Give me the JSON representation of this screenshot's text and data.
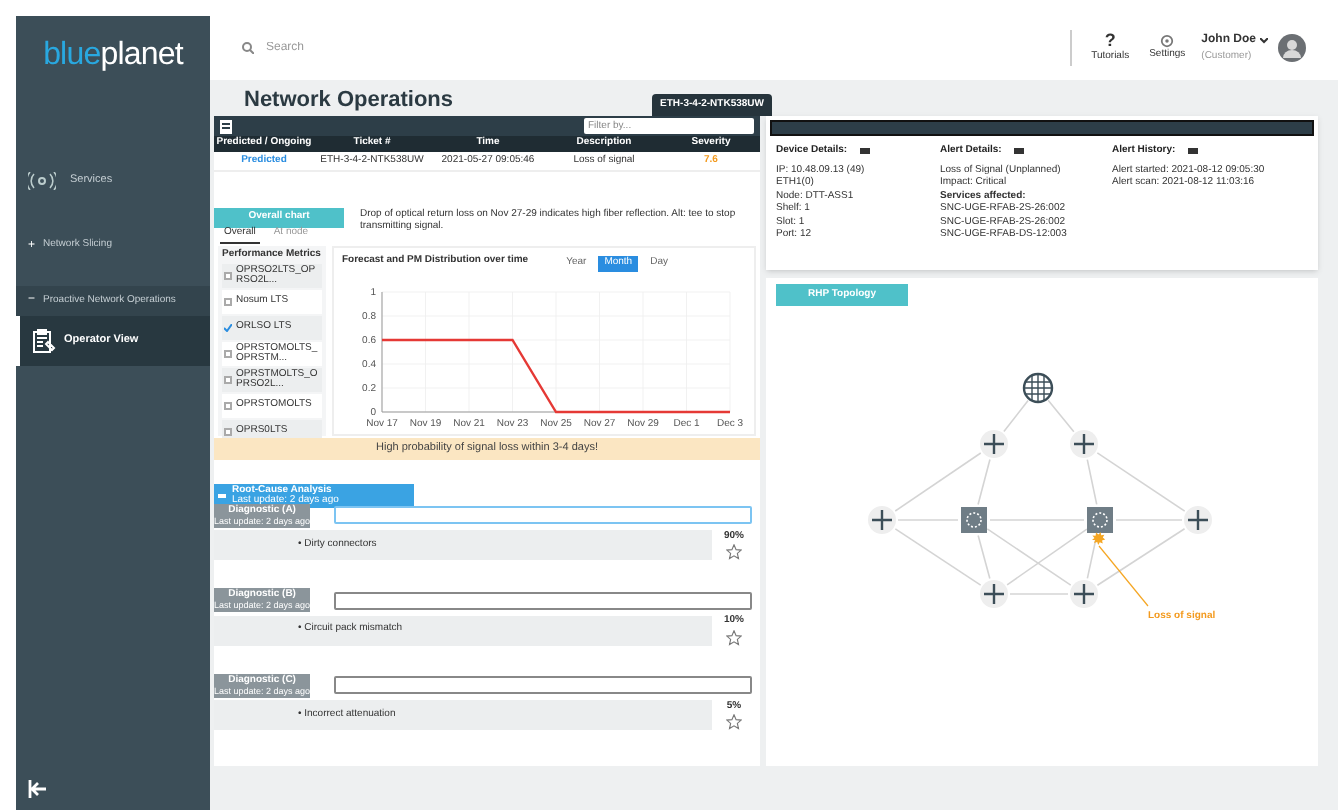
{
  "sidebar": {
    "logo": {
      "part_1": "blue",
      "part_2": "planet"
    },
    "items": [
      {
        "kind": "icon",
        "label": "Services",
        "selected": false
      },
      {
        "kind": "expand",
        "marker": "+",
        "label": "Network Slicing",
        "selected": false
      },
      {
        "kind": "expand",
        "marker": "−",
        "label": "Proactive Network Operations",
        "selected": false
      },
      {
        "kind": "sub",
        "label": "Operator View",
        "selected": true
      }
    ]
  },
  "topbar": {
    "search": {
      "placeholder": "Search"
    },
    "tutorials": {
      "glyph": "?",
      "label": "Tutorials"
    },
    "settings": {
      "label": "Settings"
    },
    "user": {
      "name": "John Doe",
      "role": "(Customer)"
    }
  },
  "page": {
    "title": "Network Operations",
    "badge": "ETH-3-4-2-NTK538UW"
  },
  "tickets": {
    "filter": {
      "placeholder": "Filter by..."
    },
    "columns": [
      "Predicted / Ongoing",
      "Ticket #",
      "Time",
      "Description",
      "Severity"
    ],
    "rows": [
      {
        "status": "Predicted",
        "ticket": "ETH-3-4-2-NTK538UW",
        "time": "2021-05-27 09:05:46",
        "description": "Loss of signal",
        "severity": "7.6"
      }
    ]
  },
  "overall": {
    "tab": "Overall chart",
    "note": "Drop of optical return loss on Nov 27-29 indicates high fiber reflection. Alt: tee to stop transmitting signal.",
    "view_tabs": [
      {
        "label": "Overall",
        "selected": true
      },
      {
        "label": "At node",
        "selected": false
      }
    ],
    "metrics": {
      "title": "Performance Metrics",
      "items": [
        {
          "label": "OPRSO2LTS_OPRSO2L...",
          "checked": false
        },
        {
          "label": "Nosum LTS",
          "checked": false
        },
        {
          "label": "ORLSO LTS",
          "checked": true
        },
        {
          "label": "OPRSTOMOLTS_OPRSTM...",
          "checked": false
        },
        {
          "label": "OPRSTMOLTS_OPRSO2L...",
          "checked": false
        },
        {
          "label": "OPRSTOMOLTS",
          "checked": false
        },
        {
          "label": "OPRS0LTS",
          "checked": false
        }
      ]
    },
    "chart": {
      "periods": [
        {
          "label": "Year",
          "selected": false
        },
        {
          "label": "Month",
          "selected": true
        },
        {
          "label": "Day",
          "selected": false
        }
      ],
      "chart_data": {
        "type": "line",
        "title": "Forecast and PM Distribution over time",
        "categories": [
          "Nov 17",
          "Nov 19",
          "Nov 21",
          "Nov 23",
          "Nov 25",
          "Nov 27",
          "Nov 29",
          "Dec 1",
          "Dec 3"
        ],
        "series": [
          {
            "color": "#e53935",
            "values": [
              0.6,
              0.6,
              0.6,
              0.6,
              0,
              0,
              0,
              0,
              0
            ]
          }
        ],
        "grid": true,
        "ylim": [
          0,
          1
        ],
        "yticks": [
          0,
          0.2,
          0.4,
          0.6,
          0.8,
          1
        ]
      }
    },
    "banner": "High probability of signal loss within 3-4 days!"
  },
  "rca": {
    "title": "Root-Cause Analysis",
    "updated": "Last update: 2 days ago",
    "diagnostics": [
      {
        "label": "Diagnostic (A)",
        "updated": "Last update: 2 days ago",
        "focused": true,
        "cause": "• Dirty connectors",
        "percent": "90%"
      },
      {
        "label": "Diagnostic (B)",
        "updated": "Last update: 2 days ago",
        "focused": false,
        "cause": "• Circuit pack mismatch",
        "percent": "10%"
      },
      {
        "label": "Diagnostic (C)",
        "updated": "Last update: 2 days ago",
        "focused": false,
        "cause": "• Incorrect attenuation",
        "percent": "5%"
      }
    ]
  },
  "details": {
    "columns": [
      {
        "title": "Device Details:",
        "lines": [
          {
            "text": "IP: 10.48.09.13 (49)",
            "bold": false
          },
          {
            "text": "ETH1(0)",
            "bold": false
          },
          {
            "text": "Node: DTT-ASS1",
            "bold": false
          },
          {
            "text": "Shelf: 1",
            "bold": false
          },
          {
            "text": "Slot: 1",
            "bold": false
          },
          {
            "text": "Port: 12",
            "bold": false
          }
        ]
      },
      {
        "title": "Alert Details:",
        "lines": [
          {
            "text": "Loss of Signal (Unplanned)",
            "bold": false
          },
          {
            "text": "Impact: Critical",
            "bold": false
          },
          {
            "text": "Services affected:",
            "bold": true
          },
          {
            "text": "SNC-UGE-RFAB-2S-26:002",
            "bold": false
          },
          {
            "text": "SNC-UGE-RFAB-2S-26:002",
            "bold": false
          },
          {
            "text": "SNC-UGE-RFAB-DS-12:003",
            "bold": false
          }
        ]
      },
      {
        "title": "Alert History:",
        "lines": [
          {
            "text": "Alert started: 2021-08-12  09:05:30",
            "bold": false
          },
          {
            "text": "Alert scan: 2021-08-12  11:03:16",
            "bold": false
          }
        ]
      }
    ]
  },
  "topology": {
    "tab": "RHP Topology",
    "alert_label": "Loss of signal",
    "nodes": [
      {
        "kind": "globe",
        "alarm": false
      },
      {
        "kind": "router",
        "alarm": false
      },
      {
        "kind": "router",
        "alarm": false
      },
      {
        "kind": "router",
        "alarm": false
      },
      {
        "kind": "switch",
        "alarm": false
      },
      {
        "kind": "switch",
        "alarm": true
      },
      {
        "kind": "router",
        "alarm": false
      },
      {
        "kind": "router",
        "alarm": false
      },
      {
        "kind": "router",
        "alarm": false
      }
    ]
  }
}
